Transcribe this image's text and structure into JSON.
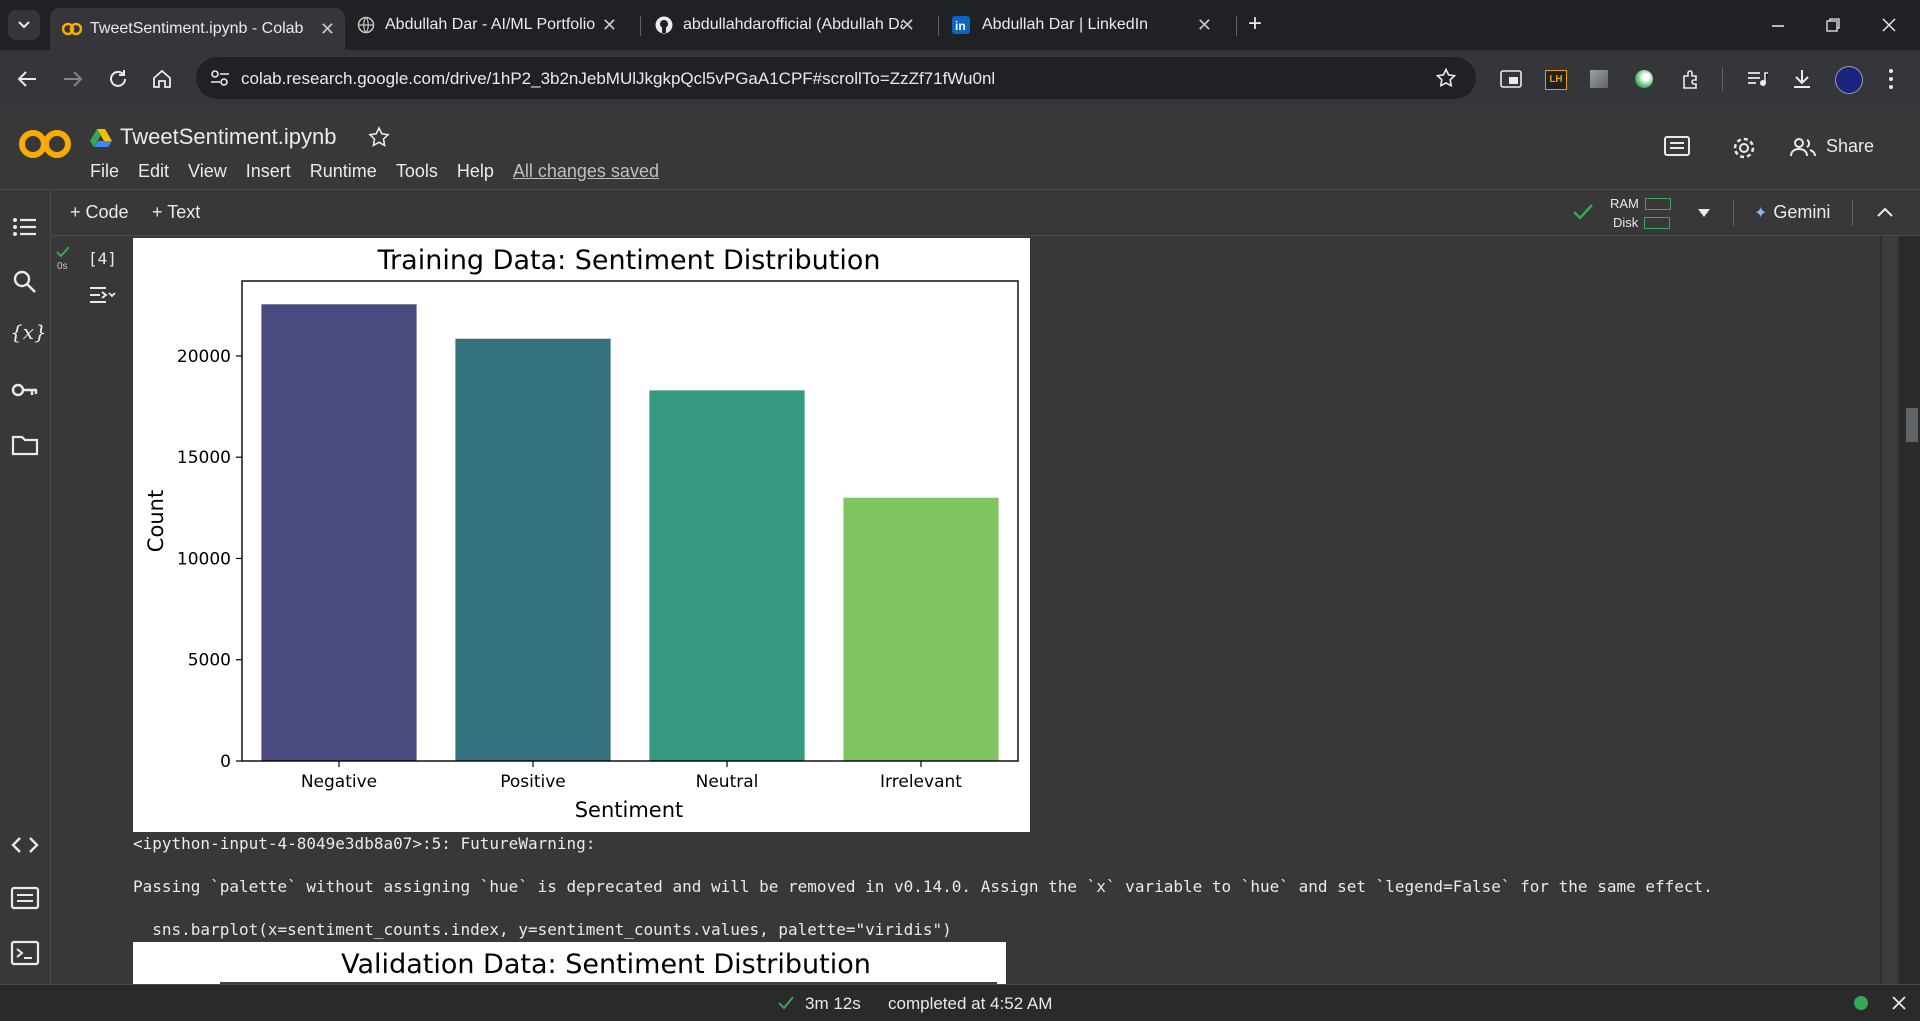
{
  "browser": {
    "tabs": [
      {
        "title": "TweetSentiment.ipynb - Colab",
        "icon": "colab-icon",
        "active": true
      },
      {
        "title": "Abdullah Dar - AI/ML Portfolio",
        "icon": "globe-icon"
      },
      {
        "title": "abdullahdarofficial (Abdullah Da",
        "icon": "github-icon"
      },
      {
        "title": "Abdullah Dar | LinkedIn",
        "icon": "linkedin-icon"
      }
    ],
    "url": "colab.research.google.com/drive/1hP2_3b2nJebMUlJkgkpQcl5vPGaA1CPF#scrollTo=ZzZf71fWu0nl"
  },
  "colab": {
    "logo": "CO",
    "doc_title": "TweetSentiment.ipynb",
    "menus": [
      "File",
      "Edit",
      "View",
      "Insert",
      "Runtime",
      "Tools",
      "Help"
    ],
    "saved_status": "All changes saved",
    "share_label": "Share",
    "add_code": "Code",
    "add_text": "Text",
    "ram_label": "RAM",
    "disk_label": "Disk",
    "gemini_label": "Gemini"
  },
  "cell": {
    "exec_count": "[4]",
    "exec_time": "0s"
  },
  "chart_data": [
    {
      "type": "bar",
      "title": "Training Data: Sentiment Distribution",
      "xlabel": "Sentiment",
      "ylabel": "Count",
      "categories": [
        "Negative",
        "Positive",
        "Neutral",
        "Irrelevant"
      ],
      "values": [
        22550,
        20850,
        18300,
        13000
      ],
      "colors": [
        "#4a4a7e",
        "#33717c",
        "#359a80",
        "#81c462"
      ],
      "yticks": [
        0,
        5000,
        10000,
        15000,
        20000
      ],
      "ylim": [
        0,
        23700
      ]
    },
    {
      "type": "bar",
      "title": "Validation Data: Sentiment Distribution"
    }
  ],
  "output": {
    "warning_line": "<ipython-input-4-8049e3db8a07>:5: FutureWarning:",
    "warning_text": "Passing `palette` without assigning `hue` is deprecated and will be removed in v0.14.0. Assign the `x` variable to `hue` and set `legend=False` for the same effect.",
    "code_line": "  sns.barplot(x=sentiment_counts.index, y=sentiment_counts.values, palette=\"viridis\")"
  },
  "status": {
    "duration": "3m 12s",
    "completed": "completed at 4:52 AM"
  }
}
